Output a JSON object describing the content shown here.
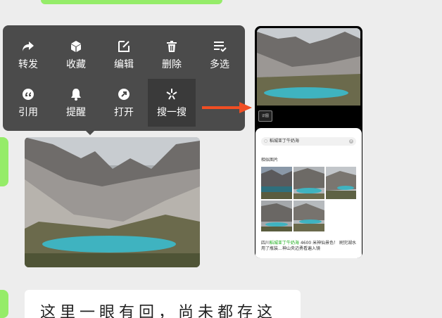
{
  "menu": {
    "items": [
      {
        "label": "转发",
        "icon": "forward-icon"
      },
      {
        "label": "收藏",
        "icon": "favorite-cube-icon"
      },
      {
        "label": "编辑",
        "icon": "edit-icon"
      },
      {
        "label": "删除",
        "icon": "trash-icon"
      },
      {
        "label": "多选",
        "icon": "multi-select-icon"
      },
      {
        "label": "引用",
        "icon": "quote-icon"
      },
      {
        "label": "提醒",
        "icon": "bell-icon"
      },
      {
        "label": "打开",
        "icon": "open-arrow-icon"
      },
      {
        "label": "搜一搜",
        "icon": "search-sparkle-icon"
      }
    ]
  },
  "phone_preview": {
    "scan_badge": "识图",
    "search_query": "稻城亚丁牛奶海",
    "section_title": "相似图片",
    "result_highlight": "稻城亚丁牛奶海",
    "result_prefix": "四川",
    "result_rest": " 4600 米神仙景色！ 刷完湖水用了瓶装…神山央迈勇看遍入镜"
  },
  "bottom_message": {
    "text": "这里一眼有回，尚未都存这"
  },
  "colors": {
    "menu_bg": "#4b4b4b",
    "arrow": "#f04e23",
    "wechat_green": "#95ec69",
    "lake": "#3fb3c0"
  }
}
